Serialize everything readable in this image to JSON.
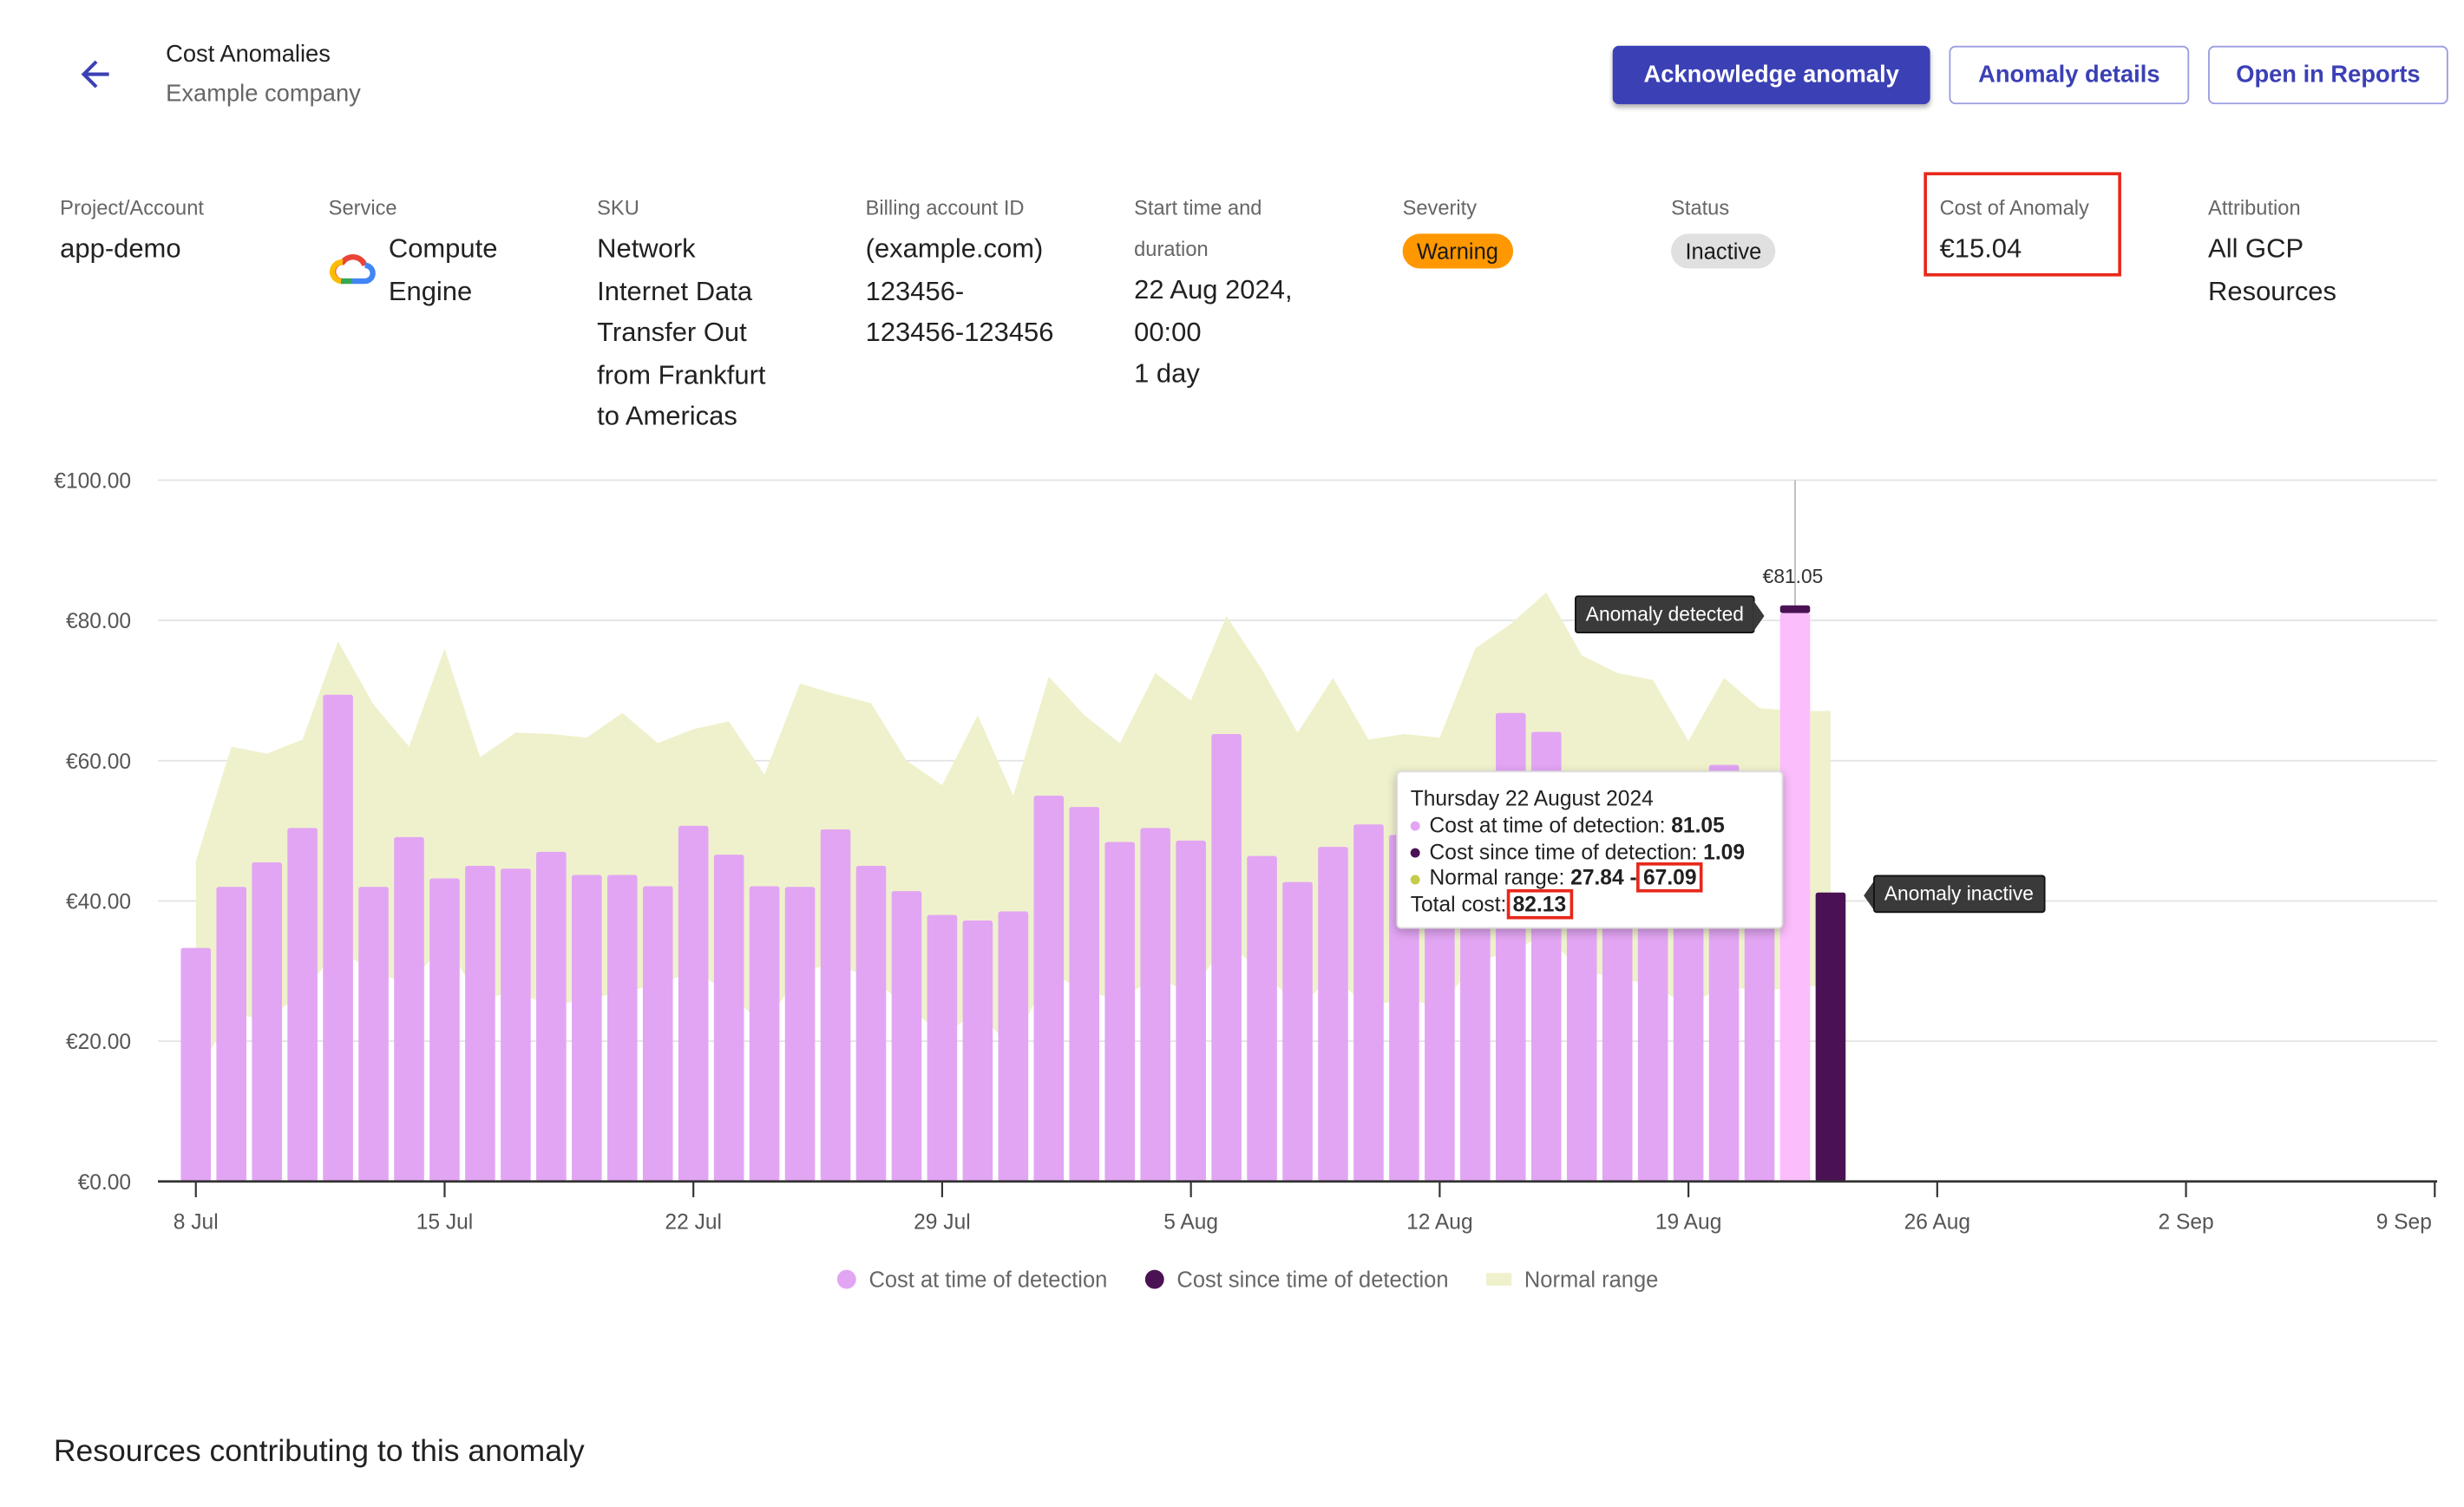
{
  "header": {
    "title": "Cost Anomalies",
    "subtitle": "Example company",
    "back_icon": "arrow-left-icon"
  },
  "actions": {
    "acknowledge": "Acknowledge anomaly",
    "details": "Anomaly details",
    "reports": "Open in Reports"
  },
  "colors": {
    "accent": "#3b40b5",
    "warning": "#ff9800",
    "inactive": "#e0e0e0",
    "cost_at": "#e2a5f3",
    "cost_at_hover": "#fbbdfb",
    "cost_since": "#4a1254",
    "normal_range": "#eff1cc",
    "highlight": "#e8281b"
  },
  "meta": [
    {
      "label": "Project/Account",
      "value": [
        "app-demo"
      ]
    },
    {
      "label": "Service",
      "value": [
        "Compute",
        "Engine"
      ],
      "icon": "google-cloud-icon"
    },
    {
      "label": "SKU",
      "value": [
        "Network",
        "Internet Data",
        "Transfer Out",
        "from Frankfurt",
        "to Americas"
      ]
    },
    {
      "label": "Billing account ID",
      "value": [
        "(example.com)",
        "123456-",
        "123456-123456"
      ]
    },
    {
      "label": "Start time and",
      "label2": "duration",
      "value": [
        "22 Aug 2024,",
        "00:00",
        "1 day"
      ]
    },
    {
      "label": "Severity",
      "chip": "Warning"
    },
    {
      "label": "Status",
      "chip": "Inactive"
    },
    {
      "label": "Cost of Anomaly",
      "value": [
        "€15.04"
      ]
    },
    {
      "label": "Attribution",
      "value": [
        "All GCP",
        "Resources"
      ]
    }
  ],
  "chart_data": {
    "type": "bar",
    "ylim": [
      0,
      100
    ],
    "yticks": [
      "€0.00",
      "€20.00",
      "€40.00",
      "€60.00",
      "€80.00",
      "€100.00"
    ],
    "xticks": [
      "8 Jul",
      "15 Jul",
      "22 Jul",
      "29 Jul",
      "5 Aug",
      "12 Aug",
      "19 Aug",
      "26 Aug",
      "2 Sep",
      "9 Sep"
    ],
    "grid": true,
    "legend_position": "bottom",
    "categories": [
      "8 Jul",
      "9 Jul",
      "10 Jul",
      "11 Jul",
      "12 Jul",
      "13 Jul",
      "14 Jul",
      "15 Jul",
      "16 Jul",
      "17 Jul",
      "18 Jul",
      "19 Jul",
      "20 Jul",
      "21 Jul",
      "22 Jul",
      "23 Jul",
      "24 Jul",
      "25 Jul",
      "26 Jul",
      "27 Jul",
      "28 Jul",
      "29 Jul",
      "30 Jul",
      "31 Jul",
      "1 Aug",
      "2 Aug",
      "3 Aug",
      "4 Aug",
      "5 Aug",
      "6 Aug",
      "7 Aug",
      "8 Aug",
      "9 Aug",
      "10 Aug",
      "11 Aug",
      "12 Aug",
      "13 Aug",
      "14 Aug",
      "15 Aug",
      "16 Aug",
      "17 Aug",
      "18 Aug",
      "19 Aug",
      "20 Aug",
      "21 Aug",
      "22 Aug",
      "23 Aug"
    ],
    "series": [
      {
        "name": "Cost at time of detection",
        "values": [
          33.3,
          42,
          45.5,
          50.4,
          69.4,
          42,
          49.1,
          43.2,
          45,
          44.6,
          47,
          43.7,
          43.7,
          42.1,
          50.7,
          46.6,
          42.1,
          42,
          50.2,
          45,
          41.4,
          38,
          37.2,
          38.5,
          55,
          53.4,
          48.4,
          50.4,
          48.6,
          63.8,
          46.4,
          42.7,
          47.7,
          50.9,
          49.4,
          45,
          46,
          66.8,
          64.1,
          44,
          43,
          41,
          42,
          59.4,
          40,
          81.05,
          0
        ]
      },
      {
        "name": "Cost since time of detection",
        "values": [
          0,
          0,
          0,
          0,
          0,
          0,
          0,
          0,
          0,
          0,
          0,
          0,
          0,
          0,
          0,
          0,
          0,
          0,
          0,
          0,
          0,
          0,
          0,
          0,
          0,
          0,
          0,
          0,
          0,
          0,
          0,
          0,
          0,
          0,
          0,
          0,
          0,
          0,
          0,
          0,
          0,
          0,
          0,
          0,
          0,
          1.09,
          41.2
        ]
      },
      {
        "name": "Normal range",
        "type": "area",
        "upper": [
          45.7,
          62,
          61,
          63,
          77,
          68,
          62,
          76,
          60.5,
          64,
          63.8,
          63.3,
          66.8,
          62.5,
          64.5,
          65.6,
          58,
          71,
          69.5,
          68.2,
          60,
          56.5,
          66.5,
          55,
          72,
          66.5,
          62.5,
          72.5,
          68.6,
          80.6,
          73,
          64,
          71.8,
          63,
          63.8,
          63.3,
          76,
          79.5,
          84,
          75,
          72.5,
          71.5,
          62.8,
          71.8,
          67.5,
          67.09,
          67.09
        ],
        "lower": [
          15,
          24,
          23,
          27,
          33,
          30,
          28,
          34,
          26,
          27,
          25,
          26,
          27,
          28,
          30,
          27,
          22,
          30,
          31,
          29,
          25,
          21,
          24,
          19,
          30,
          27,
          26,
          29,
          27,
          34,
          30,
          25,
          29,
          25,
          26,
          25,
          31,
          33,
          35,
          30,
          29,
          28,
          25,
          28,
          27,
          27.84,
          27.84
        ]
      }
    ],
    "annotations": {
      "peak_label": "€81.05",
      "detected": "Anomaly detected",
      "inactive": "Anomaly inactive"
    },
    "tooltip": {
      "date": "Thursday 22 August 2024",
      "cost_at_label": "Cost at time of detection:",
      "cost_at": "81.05",
      "cost_since_label": "Cost since time of detection:",
      "cost_since": "1.09",
      "range_label": "Normal range:",
      "range_low": "27.84",
      "range_sep": "-",
      "range_high": "67.09",
      "total_label": "Total cost:",
      "total": "82.13"
    }
  },
  "section": {
    "resources_heading": "Resources contributing to this anomaly"
  }
}
